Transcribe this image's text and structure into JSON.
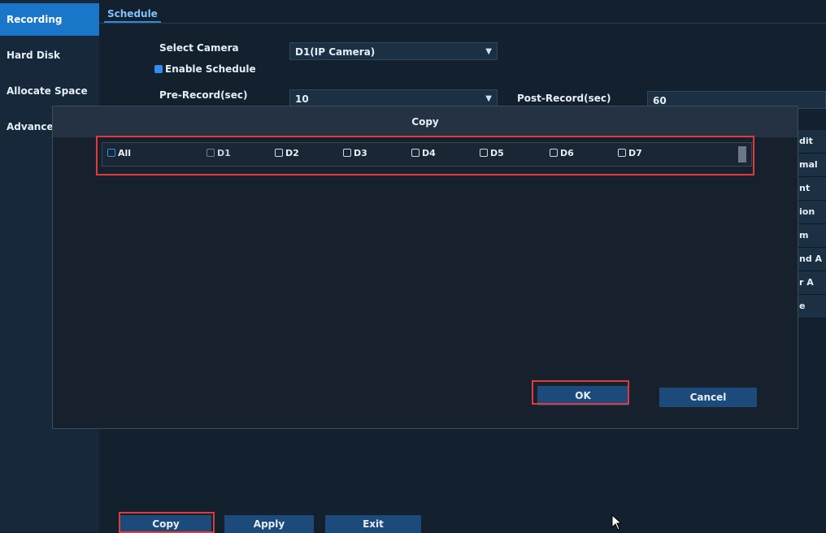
{
  "sidebar": {
    "items": [
      {
        "label": "Recording",
        "active": true
      },
      {
        "label": "Hard Disk",
        "active": false
      },
      {
        "label": "Allocate Space",
        "active": false
      },
      {
        "label": "Advanced",
        "active": false
      }
    ]
  },
  "tabs": [
    {
      "label": "Schedule",
      "active": true
    }
  ],
  "form": {
    "select_camera_label": "Select Camera",
    "select_camera_value": "D1(IP Camera)",
    "enable_schedule_label": "Enable Schedule",
    "pre_record_label": "Pre-Record(sec)",
    "pre_record_value": "10",
    "post_record_label": "Post-Record(sec)",
    "post_record_value": "60"
  },
  "right_truncated_items": [
    "dit",
    "mal",
    "nt",
    "ion",
    "m",
    "nd A",
    "r A",
    "e"
  ],
  "dialog": {
    "title": "Copy",
    "cameras": [
      {
        "label": "All",
        "checked": false,
        "disabled": false
      },
      {
        "label": "D1",
        "checked": false,
        "disabled": true
      },
      {
        "label": "D2",
        "checked": false,
        "disabled": false
      },
      {
        "label": "D3",
        "checked": false,
        "disabled": false
      },
      {
        "label": "D4",
        "checked": false,
        "disabled": false
      },
      {
        "label": "D5",
        "checked": false,
        "disabled": false
      },
      {
        "label": "D6",
        "checked": false,
        "disabled": false
      },
      {
        "label": "D7",
        "checked": false,
        "disabled": false
      }
    ],
    "ok_label": "OK",
    "cancel_label": "Cancel"
  },
  "bottom_buttons": {
    "copy_label": "Copy",
    "apply_label": "Apply",
    "exit_label": "Exit"
  },
  "colors": {
    "accent": "#1976c9",
    "highlight": "#e03a3a"
  }
}
